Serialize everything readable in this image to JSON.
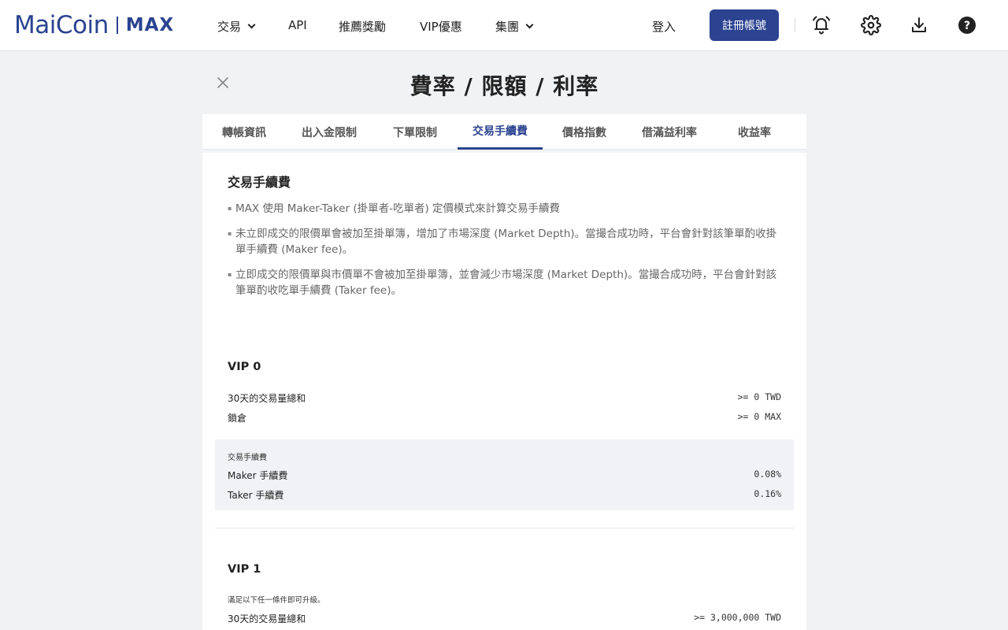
{
  "brand": {
    "name": "MaiCoin",
    "product": "MAX",
    "color": "#2b4390"
  },
  "nav": {
    "trade": "交易",
    "api": "API",
    "referral": "推薦獎勵",
    "vip": "VIP優惠",
    "group": "集團",
    "login": "登入",
    "signup": "註冊帳號",
    "icons": [
      "bell-icon",
      "gear-icon",
      "download-icon",
      "help-icon"
    ]
  },
  "page": {
    "title": "費率 / 限額 / 利率",
    "tabs": [
      "轉帳資訊",
      "出入金限制",
      "下單限制",
      "交易手續費",
      "價格指數",
      "借滿益利率",
      "收益率"
    ],
    "active_tab": "交易手續費"
  },
  "fees": {
    "title": "交易手續費",
    "bullets": [
      "MAX 使用 Maker-Taker (掛單者-吃單者) 定價模式來計算交易手續費",
      "未立即成交的限價單會被加至掛單簿，增加了市場深度 (Market Depth)。當撮合成功時，平台會針對該筆單酌收掛單手續費 (Maker fee)。",
      "立即成交的限價單與市價單不會被加至掛單簿，並會減少市場深度 (Market Depth)。當撮合成功時，平台會針對該筆單酌收吃單手續費 (Taker fee)。"
    ],
    "vip0": {
      "title": "VIP 0",
      "volume_label": "30天的交易量總和",
      "volume_value": ">= 0 TWD",
      "lock_label": "鎖倉",
      "lock_value": ">= 0 MAX",
      "fee_section_label": "交易手續費",
      "maker_label": "Maker 手續費",
      "maker_value": "0.08%",
      "taker_label": "Taker 手續費",
      "taker_value": "0.16%"
    },
    "vip1": {
      "title": "VIP 1",
      "note": "滿足以下任一條件即可升級。",
      "volume_label": "30天的交易量總和",
      "volume_value": ">= 3,000,000 TWD"
    }
  }
}
